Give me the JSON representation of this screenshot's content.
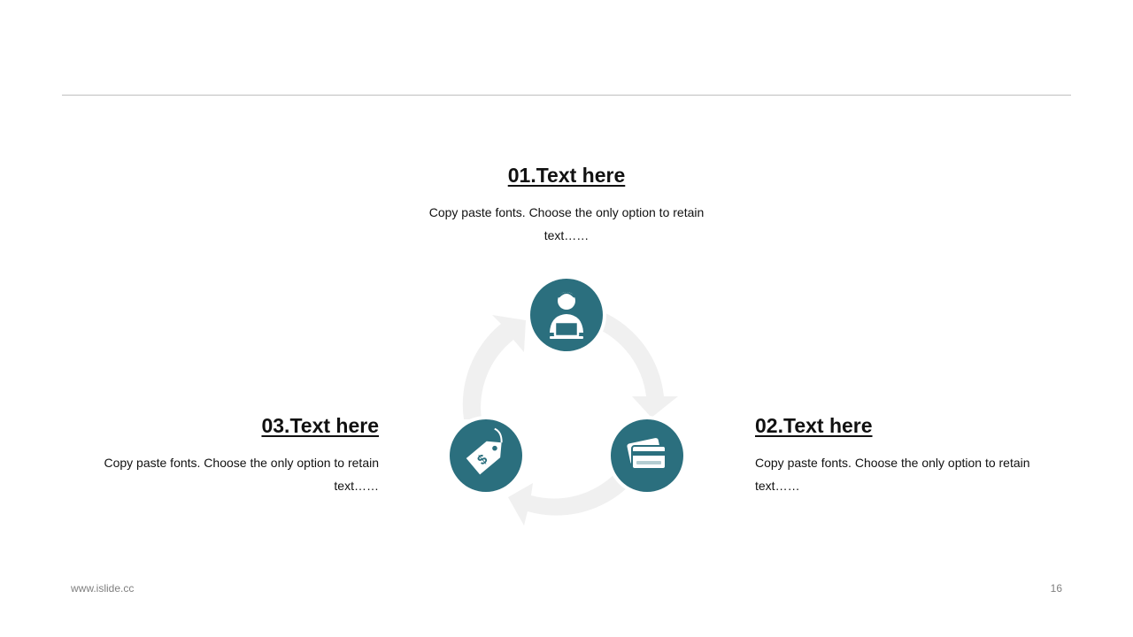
{
  "colors": {
    "accent": "#2b6f7e",
    "arrow": "#f0f0f0",
    "rule": "#bfbfbf",
    "footer": "#7f7f7f"
  },
  "items": [
    {
      "title": "01.Text here",
      "body_line1": "Copy paste fonts. Choose the only option to retain",
      "body_line2": "text……",
      "icon": "user-laptop-icon"
    },
    {
      "title": "02.Text here",
      "body_line1": "Copy paste fonts. Choose the only option to retain",
      "body_line2": "text……",
      "icon": "credit-card-icon"
    },
    {
      "title": "03.Text here",
      "body_line1": "Copy paste fonts. Choose the only option to retain",
      "body_line2": "text……",
      "icon": "price-tag-icon"
    }
  ],
  "footer": {
    "website": "www.islide.cc",
    "page_number": "16"
  }
}
